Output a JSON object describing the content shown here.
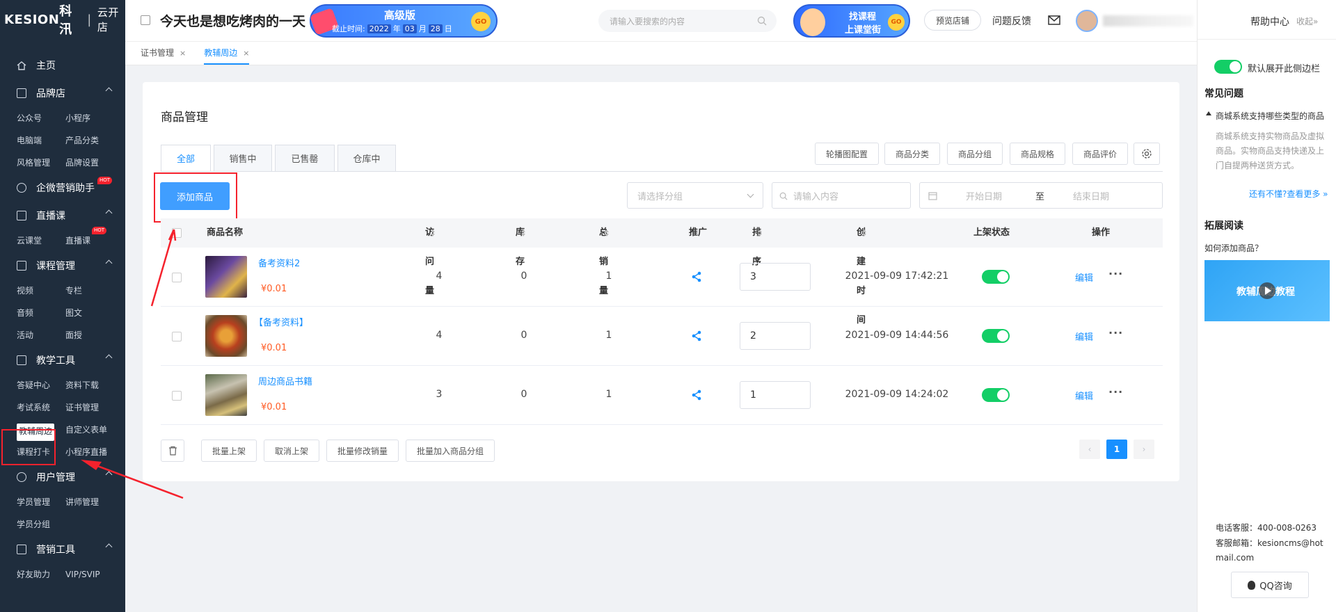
{
  "sidebar": {
    "logo": {
      "brand": "KESION",
      "cn": "科汛",
      "sub": "云开店"
    },
    "home": "主页",
    "groups": [
      {
        "label": "品牌店",
        "items": [
          "公众号",
          "小程序",
          "电脑端",
          "产品分类",
          "风格管理",
          "品牌设置"
        ]
      },
      {
        "label": "企微营销助手",
        "hot": "HOT",
        "items": []
      },
      {
        "label": "直播课",
        "items": [
          "云课堂",
          "直播课"
        ],
        "hot_item": "HOT"
      },
      {
        "label": "课程管理",
        "items": [
          "视频",
          "专栏",
          "音频",
          "图文",
          "活动",
          "面授"
        ]
      },
      {
        "label": "教学工具",
        "items": [
          "答疑中心",
          "资料下载",
          "考试系统",
          "证书管理",
          "教辅周边",
          "自定义表单",
          "课程打卡",
          "小程序直播"
        ]
      },
      {
        "label": "用户管理",
        "items": [
          "学员管理",
          "讲师管理",
          "学员分组"
        ]
      },
      {
        "label": "营销工具",
        "items": [
          "好友助力",
          "VIP/SVIP"
        ]
      }
    ]
  },
  "topbar": {
    "title": "今天也是想吃烤肉的一天",
    "banner": {
      "title": "高级版",
      "deadline_label": "截止时间:",
      "year": "2022",
      "year_unit": "年",
      "month": "03",
      "month_unit": "月",
      "day": "28",
      "day_unit": "日",
      "go": "GO"
    },
    "search_placeholder": "请输入要搜索的内容",
    "promo": {
      "line1": "找课程",
      "line2": "上课堂街",
      "go": "GO"
    },
    "preview_btn": "预览店铺",
    "feedback": "问题反馈"
  },
  "tabs": [
    {
      "label": "证书管理",
      "close": "×"
    },
    {
      "label": "教辅周边",
      "close": "×"
    }
  ],
  "main": {
    "title": "商品管理",
    "segments": [
      "全部",
      "销售中",
      "已售罄",
      "仓库中"
    ],
    "config_buttons": [
      "轮播图配置",
      "商品分类",
      "商品分组",
      "商品规格",
      "商品评价"
    ],
    "add_button": "添加商品",
    "filters": {
      "group_placeholder": "请选择分组",
      "content_placeholder": "请输入内容",
      "start_date": "开始日期",
      "range_sep": "至",
      "end_date": "结束日期"
    },
    "columns": [
      "商品名称",
      "访问量",
      "库存",
      "总销量",
      "推广",
      "排序",
      "创建时间",
      "上架状态",
      "操作"
    ],
    "rows": [
      {
        "name": "备考资料2",
        "price": "¥0.01",
        "visits": "4",
        "stock": "0",
        "sales": "1",
        "sort": "3",
        "created": "2021-09-09 17:42:21",
        "edit": "编辑",
        "on_shelf": true
      },
      {
        "name": "【备考资料】",
        "price": "¥0.01",
        "visits": "4",
        "stock": "0",
        "sales": "1",
        "sort": "2",
        "created": "2021-09-09 14:44:56",
        "edit": "编辑",
        "on_shelf": true
      },
      {
        "name": "周边商品书籍",
        "price": "¥0.01",
        "visits": "3",
        "stock": "0",
        "sales": "1",
        "sort": "1",
        "created": "2021-09-09 14:24:02",
        "edit": "编辑",
        "on_shelf": true
      }
    ],
    "bulk_buttons": [
      "批量上架",
      "取消上架",
      "批量修改销量",
      "批量加入商品分组"
    ],
    "pagination": {
      "prev": "‹",
      "current": "1",
      "next": "›"
    }
  },
  "right_panel": {
    "help_center": "帮助中心",
    "collapse": "收起»",
    "toggle_label": "默认展开此侧边栏",
    "faq_title": "常见问题",
    "faq_q": "商城系统支持哪些类型的商品",
    "faq_a": "商城系统支持实物商品及虚拟商品。实物商品支持快递及上门自提两种送货方式。",
    "more_link": "还有不懂?查看更多 »",
    "ext_title": "拓展阅读",
    "ext_q": "如何添加商品？",
    "video_label": "教辅周边教程",
    "phone": "电话客服：400-008-0263",
    "email": "客服邮箱：kesioncms@hotmail.com",
    "qq_btn": "QQ咨询"
  },
  "colors": {
    "primary": "#1890ff",
    "sidebar_bg": "#1f2d3d",
    "switch_on": "#13ce66",
    "price": "#ff5b24",
    "annotation_red": "#f5222d"
  }
}
